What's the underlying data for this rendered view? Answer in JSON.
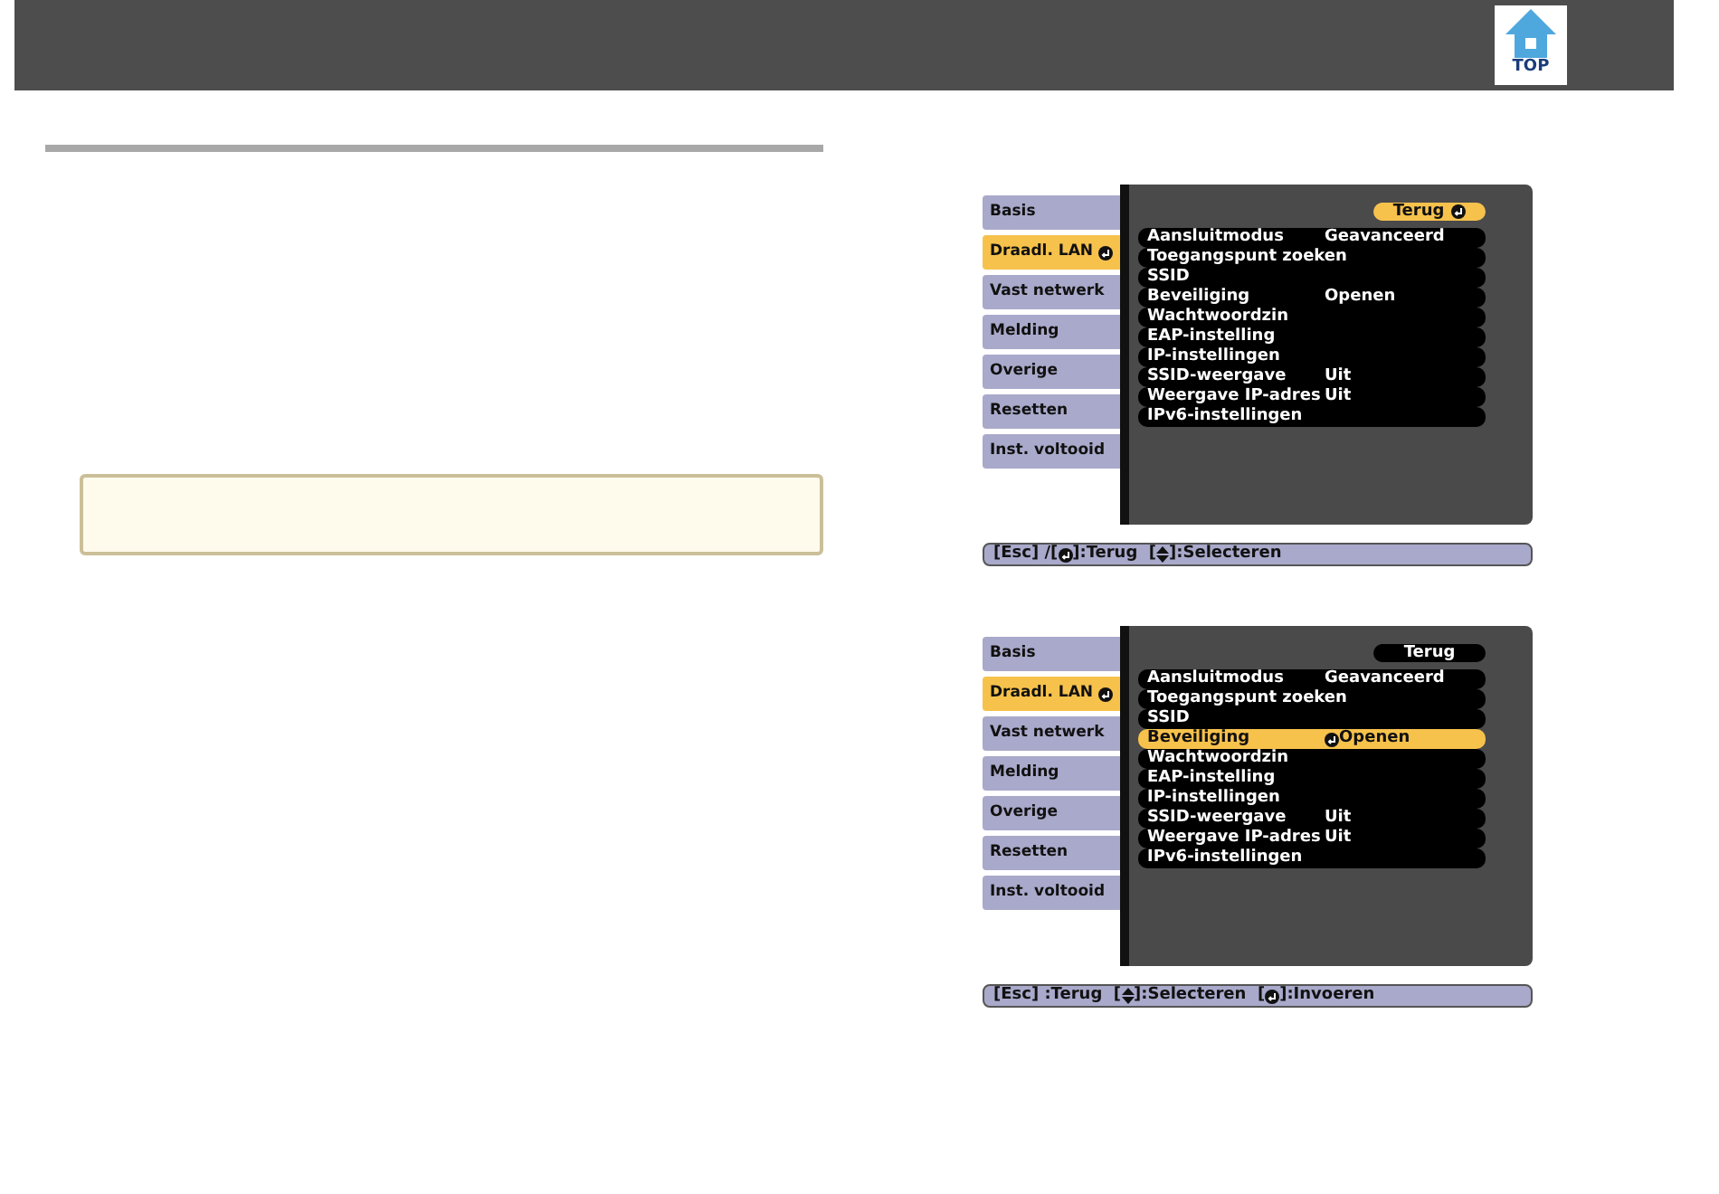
{
  "header": {
    "logo": "TOP"
  },
  "menus": [
    {
      "tabs": [
        {
          "label": "Basis",
          "selected": false
        },
        {
          "label": "Draadl. LAN",
          "selected": true
        },
        {
          "label": "Vast netwerk",
          "selected": false
        },
        {
          "label": "Melding",
          "selected": false
        },
        {
          "label": "Overige",
          "selected": false
        },
        {
          "label": "Resetten",
          "selected": false
        },
        {
          "label": "Inst. voltooid",
          "selected": false
        }
      ],
      "back": {
        "label": "Terug",
        "selected": true
      },
      "rows": [
        {
          "label": "Aansluitmodus",
          "value": "Geavanceerd",
          "selected": false
        },
        {
          "label": "Toegangspunt zoeken",
          "selected": false
        },
        {
          "label": "SSID",
          "selected": false
        },
        {
          "label": "Beveiliging",
          "value": "Openen",
          "selected": false
        },
        {
          "label": "Wachtwoordzin",
          "selected": false
        },
        {
          "label": "EAP-instelling",
          "selected": false
        },
        {
          "label": "IP-instellingen",
          "selected": false
        },
        {
          "label": "SSID-weergave",
          "value": "Uit",
          "selected": false
        },
        {
          "label": "Weergave IP-adres",
          "value": "Uit",
          "selected": false
        },
        {
          "label": "IPv6-instellingen",
          "selected": false
        }
      ],
      "footer": [
        {
          "kind": "text",
          "text": "[Esc] /["
        },
        {
          "kind": "enter"
        },
        {
          "kind": "text",
          "text": "]:Terug  ["
        },
        {
          "kind": "updown"
        },
        {
          "kind": "text",
          "text": "]:Selecteren"
        }
      ]
    },
    {
      "tabs": [
        {
          "label": "Basis",
          "selected": false
        },
        {
          "label": "Draadl. LAN",
          "selected": true
        },
        {
          "label": "Vast netwerk",
          "selected": false
        },
        {
          "label": "Melding",
          "selected": false
        },
        {
          "label": "Overige",
          "selected": false
        },
        {
          "label": "Resetten",
          "selected": false
        },
        {
          "label": "Inst. voltooid",
          "selected": false
        }
      ],
      "back": {
        "label": "Terug",
        "selected": false
      },
      "rows": [
        {
          "label": "Aansluitmodus",
          "value": "Geavanceerd",
          "selected": false
        },
        {
          "label": "Toegangspunt zoeken",
          "selected": false
        },
        {
          "label": "SSID",
          "selected": false
        },
        {
          "label": "Beveiliging",
          "value": "Openen",
          "selected": true
        },
        {
          "label": "Wachtwoordzin",
          "selected": false
        },
        {
          "label": "EAP-instelling",
          "selected": false
        },
        {
          "label": "IP-instellingen",
          "selected": false
        },
        {
          "label": "SSID-weergave",
          "value": "Uit",
          "selected": false
        },
        {
          "label": "Weergave IP-adres",
          "value": "Uit",
          "selected": false
        },
        {
          "label": "IPv6-instellingen",
          "selected": false
        }
      ],
      "footer": [
        {
          "kind": "text",
          "text": "[Esc] :Terug  ["
        },
        {
          "kind": "updown"
        },
        {
          "kind": "text",
          "text": "]:Selecteren  ["
        },
        {
          "kind": "enter"
        },
        {
          "kind": "text",
          "text": "]:Invoeren"
        }
      ]
    }
  ]
}
